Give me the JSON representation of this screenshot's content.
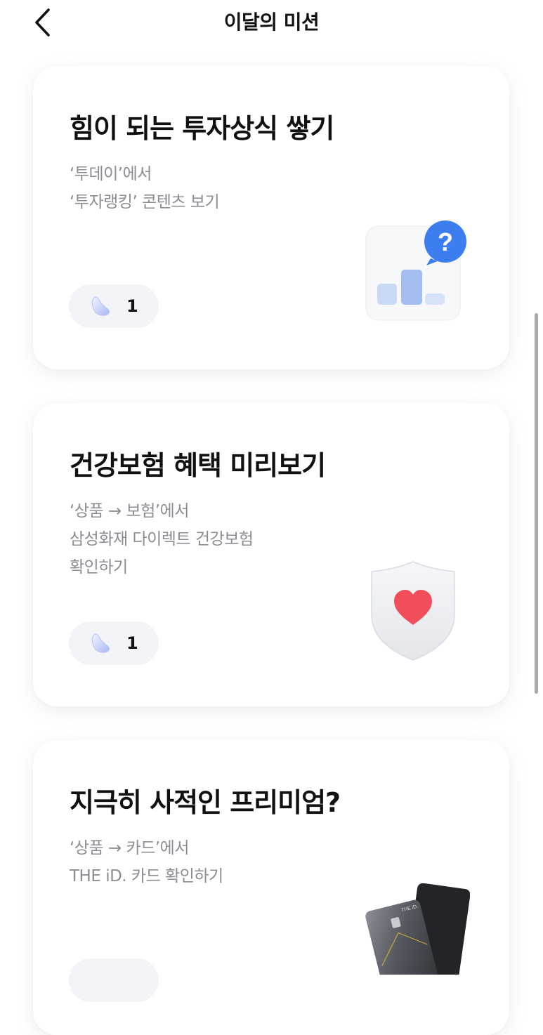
{
  "header": {
    "title": "이달의 미션",
    "back_icon": "chevron-left-icon"
  },
  "missions": [
    {
      "title": "힘이 되는 투자상식 쌓기",
      "desc": [
        "‘투데이’에서",
        "‘투자랭킹’ 콘텐츠 보기"
      ],
      "reward_icon": "jelly-bean-icon",
      "reward": "1",
      "illustration": "bar-chart-question-icon"
    },
    {
      "title": "건강보험 혜택 미리보기",
      "desc": [
        "‘상품 → 보험’에서",
        "삼성화재 다이렉트 건강보험",
        "확인하기"
      ],
      "reward_icon": "jelly-bean-icon",
      "reward": "1",
      "illustration": "shield-heart-icon"
    },
    {
      "title": "지극히 사적인 프리미엄?",
      "desc": [
        "‘상품 → 카드’에서",
        "THE iD. 카드 확인하기"
      ],
      "card_label": "THE iD.",
      "illustration": "credit-cards-icon"
    }
  ],
  "colors": {
    "accent_blue": "#3c7df0",
    "bar_light": "#c9d9f7",
    "bar_mid": "#a3bff0",
    "heart": "#f04e5a",
    "desc_gray": "#8a8d93",
    "pill_bg": "#f3f4f7"
  }
}
